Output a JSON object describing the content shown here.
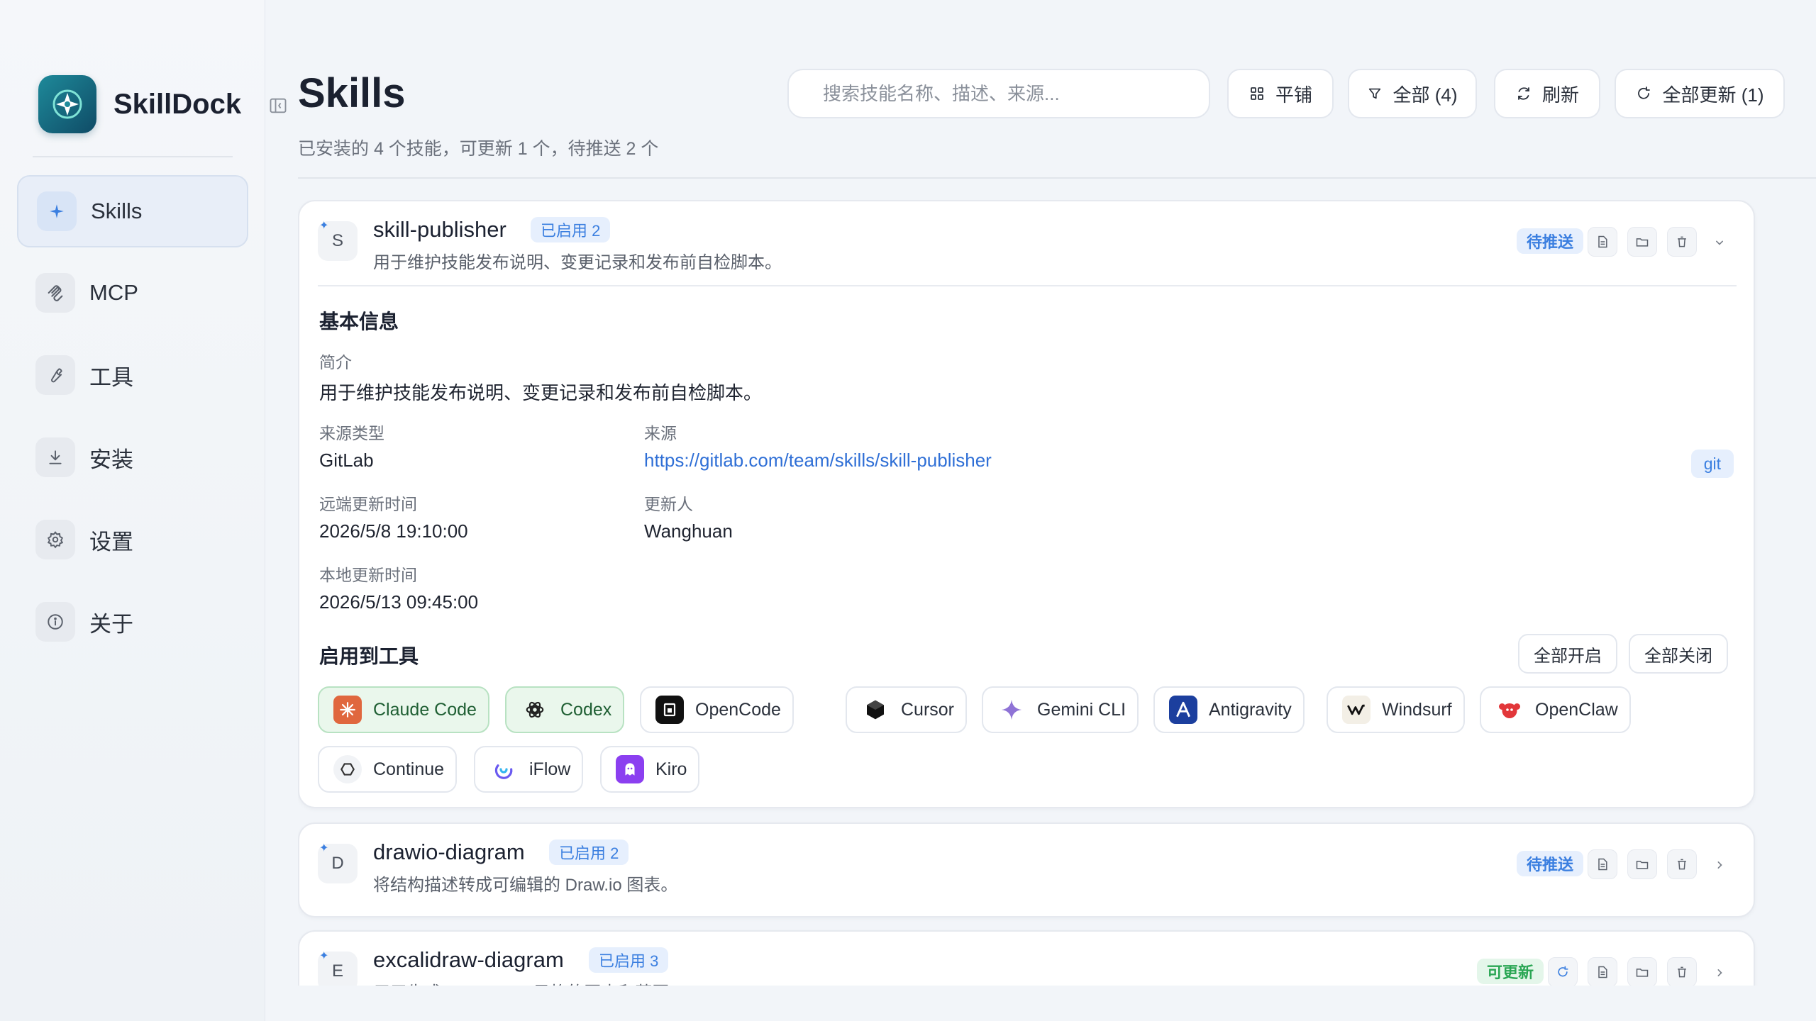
{
  "app": {
    "name": "SkillDock"
  },
  "sidebar": {
    "items": [
      {
        "label": "Skills",
        "icon": "sparkle-icon",
        "active": true
      },
      {
        "label": "MCP",
        "icon": "mcp-icon"
      },
      {
        "label": "工具",
        "icon": "wrench-icon"
      },
      {
        "label": "安装",
        "icon": "download-icon"
      },
      {
        "label": "设置",
        "icon": "gear-icon"
      },
      {
        "label": "关于",
        "icon": "info-icon"
      }
    ]
  },
  "header": {
    "title": "Skills",
    "subtitle": "已安装的 4 个技能，可更新 1 个，待推送 2 个",
    "search_placeholder": "搜索技能名称、描述、来源...",
    "view_label": "平铺",
    "filter_label": "全部 (4)",
    "refresh_label": "刷新",
    "update_all_label": "全部更新 (1)"
  },
  "skills": [
    {
      "initial": "S",
      "name": "skill-publisher",
      "enabled": "已启用 2",
      "desc": "用于维护技能发布说明、变更记录和发布前自检脚本。",
      "status": "待推送",
      "expanded": true,
      "details": {
        "basic_title": "基本信息",
        "summary_label": "简介",
        "summary": "用于维护技能发布说明、变更记录和发布前自检脚本。",
        "source_type_label": "来源类型",
        "source_type": "GitLab",
        "source_label": "来源",
        "source": "https://gitlab.com/team/skills/skill-publisher",
        "source_tag": "git",
        "remote_time_label": "远端更新时间",
        "remote_time": "2026/5/8 19:10:00",
        "updater_label": "更新人",
        "updater": "Wanghuan",
        "local_time_label": "本地更新时间",
        "local_time": "2026/5/13 09:45:00",
        "tools_title": "启用到工具",
        "enable_all": "全部开启",
        "disable_all": "全部关闭",
        "tools": [
          {
            "name": "Claude Code",
            "on": true
          },
          {
            "name": "Codex",
            "on": true
          },
          {
            "name": "OpenCode",
            "on": false
          },
          {
            "name": "Cursor",
            "on": false
          },
          {
            "name": "Gemini CLI",
            "on": false
          },
          {
            "name": "Antigravity",
            "on": false
          },
          {
            "name": "Windsurf",
            "on": false
          },
          {
            "name": "OpenClaw",
            "on": false
          },
          {
            "name": "Continue",
            "on": false
          },
          {
            "name": "iFlow",
            "on": false
          },
          {
            "name": "Kiro",
            "on": false
          }
        ]
      }
    },
    {
      "initial": "D",
      "name": "drawio-diagram",
      "enabled": "已启用 2",
      "desc": "将结构描述转成可编辑的 Draw.io 图表。",
      "status": "待推送"
    },
    {
      "initial": "E",
      "name": "excalidraw-diagram",
      "enabled": "已启用 3",
      "desc": "用于生成 Excalidraw 风格的图表和草图。",
      "status": "可更新"
    }
  ],
  "colors": {
    "accent": "#3b7fe0",
    "success": "#2aa654",
    "brand": "#1e8a9a"
  }
}
